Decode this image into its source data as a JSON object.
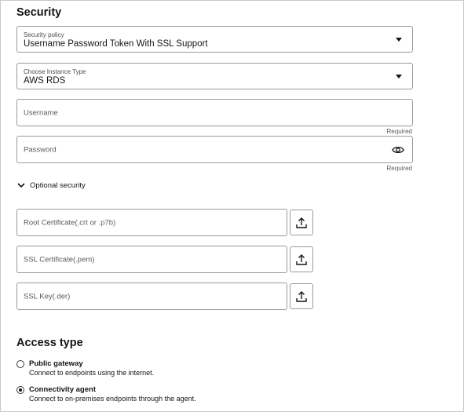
{
  "security": {
    "heading": "Security",
    "policy": {
      "label": "Security policy",
      "value": "Username Password Token With SSL Support"
    },
    "instance": {
      "label": "Choose Instance Type",
      "value": "AWS RDS"
    },
    "username": {
      "placeholder": "Username",
      "required": "Required"
    },
    "password": {
      "placeholder": "Password",
      "required": "Required"
    },
    "optional_toggle": "Optional security",
    "certs": [
      {
        "placeholder": "Root Certificate(.crt or .p7b)"
      },
      {
        "placeholder": "SSL Certificate(.pem)"
      },
      {
        "placeholder": "SSL Key(.der)"
      }
    ]
  },
  "access": {
    "heading": "Access type",
    "options": [
      {
        "title": "Public gateway",
        "desc": "Connect to endpoints using the internet.",
        "selected": false
      },
      {
        "title": "Connectivity agent",
        "desc": "Connect to on-premises endpoints through the agent.",
        "selected": true
      }
    ]
  }
}
